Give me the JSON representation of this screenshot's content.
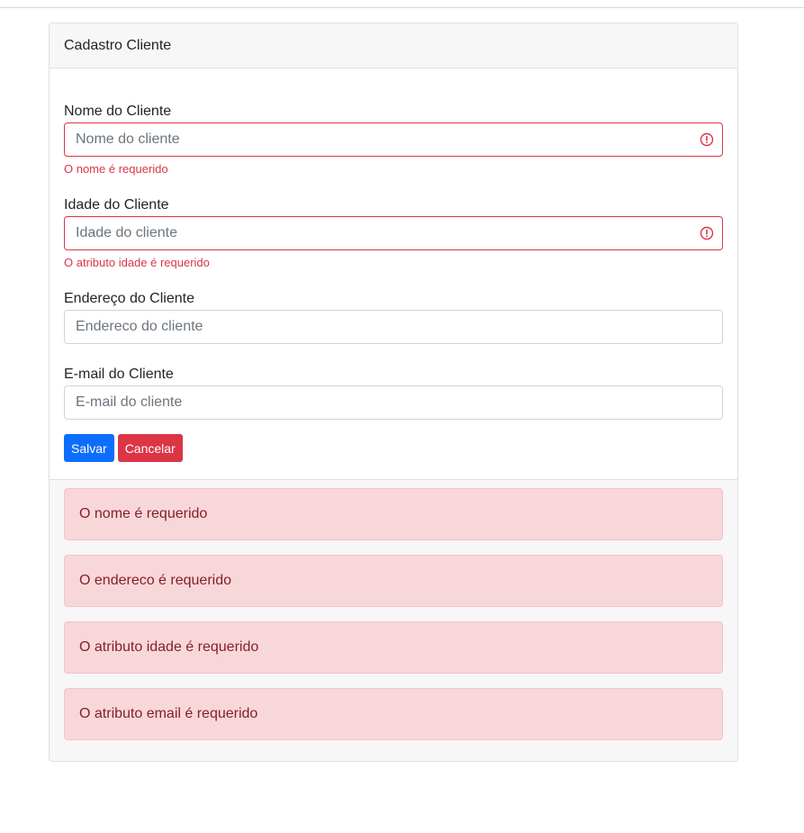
{
  "card": {
    "title": "Cadastro Cliente"
  },
  "form": {
    "nome": {
      "label": "Nome do Cliente",
      "placeholder": "Nome do cliente",
      "value": "",
      "error": "O nome é requerido"
    },
    "idade": {
      "label": "Idade do Cliente",
      "placeholder": "Idade do cliente",
      "value": "",
      "error": "O atributo idade é requerido"
    },
    "endereco": {
      "label": "Endereço do Cliente",
      "placeholder": "Endereco do cliente",
      "value": ""
    },
    "email": {
      "label": "E-mail do Cliente",
      "placeholder": "E-mail do cliente",
      "value": ""
    }
  },
  "buttons": {
    "save_label": "Salvar",
    "cancel_label": "Cancelar"
  },
  "alerts": [
    "O nome é requerido",
    "O endereco é requerido",
    "O atributo idade é requerido",
    "O atributo email é requerido"
  ],
  "icons": {
    "invalid": "exclamation-circle-icon"
  },
  "colors": {
    "primary": "#0d6efd",
    "danger": "#dc3545",
    "alert_bg": "#f8d7da",
    "alert_text": "#842029"
  }
}
